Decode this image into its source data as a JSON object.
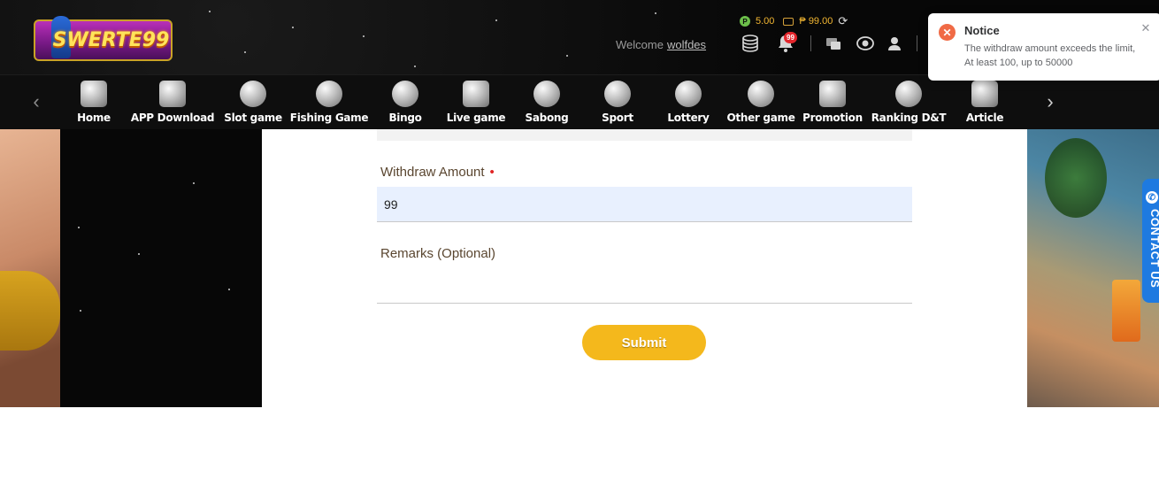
{
  "header": {
    "logo_text": "SWERTE99",
    "balance": {
      "credit": "5.00",
      "credit_symbol": "P",
      "cash": "₱ 99.00"
    },
    "welcome_text": "Welcome",
    "username": "wolfdes",
    "notification_count": "99",
    "icons": [
      "coins-icon",
      "bell-icon",
      "transfer-icon",
      "eye-icon",
      "user-icon"
    ]
  },
  "nav": {
    "items": [
      {
        "label": "Home",
        "icon": "home-icon"
      },
      {
        "label": "APP Download",
        "icon": "phone-icon"
      },
      {
        "label": "Slot game",
        "icon": "slot-icon"
      },
      {
        "label": "Fishing Game",
        "icon": "shark-icon"
      },
      {
        "label": "Bingo",
        "icon": "bingo-icon"
      },
      {
        "label": "Live game",
        "icon": "tv-icon"
      },
      {
        "label": "Sabong",
        "icon": "rooster-icon"
      },
      {
        "label": "Sport",
        "icon": "ball-icon"
      },
      {
        "label": "Lottery",
        "icon": "lottery-ball-icon"
      },
      {
        "label": "Other game",
        "icon": "chip-icon"
      },
      {
        "label": "Promotion",
        "icon": "gift-icon"
      },
      {
        "label": "Ranking D&T",
        "icon": "trophy-icon"
      },
      {
        "label": "Article",
        "icon": "scroll-icon"
      }
    ]
  },
  "form": {
    "amount_label": "Withdraw Amount",
    "amount_required_mark": "•",
    "amount_value": "99",
    "remarks_label": "Remarks (Optional)",
    "remarks_value": "",
    "submit_label": "Submit"
  },
  "contact_tab": {
    "label": "CONTACT US"
  },
  "notice": {
    "title": "Notice",
    "message": "The withdraw amount exceeds the limit, At least 100, up to 50000",
    "status_color": "#f06a45"
  },
  "colors": {
    "accent": "#f4b81c",
    "header_bg": "#0b0b0b",
    "contact_blue": "#1e7ae0"
  }
}
